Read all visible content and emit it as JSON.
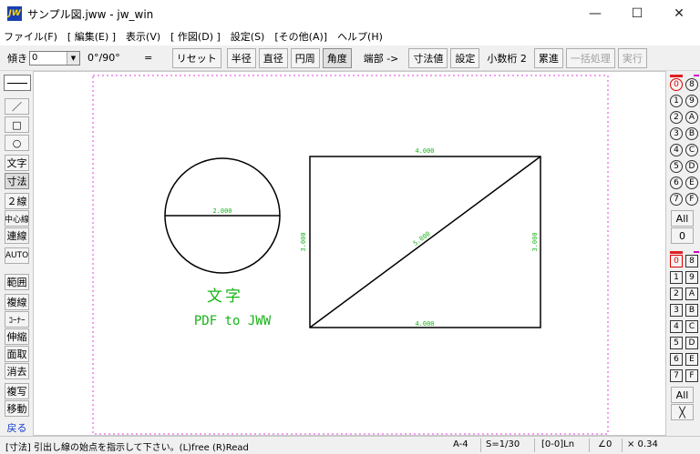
{
  "window": {
    "title": "サンプル図.jww - jw_win",
    "icon_text": "JW",
    "minimize": "—",
    "maximize": "☐",
    "close": "✕"
  },
  "menu": [
    "ファイル(F)",
    "[ 編集(E) ]",
    "表示(V)",
    "[ 作図(D) ]",
    "設定(S)",
    "[その他(A)]",
    "ヘルプ(H)"
  ],
  "toolbar": {
    "slope_label": "傾き",
    "slope_value": "0",
    "angle_toggle": "0°/90°",
    "equal": "=",
    "reset": "リセット",
    "radius": "半径",
    "diameter": "直径",
    "circumference": "円周",
    "angle": "角度",
    "end": "端部 ->",
    "dim_value": "寸法値",
    "settings": "設定",
    "decimal": "小数桁 2",
    "cumulative": "累進",
    "batch": "一括処理",
    "execute": "実行"
  },
  "left_tools": [
    "／",
    "□",
    "○",
    "文字",
    "寸法",
    "２線",
    "中心線",
    "連線",
    "AUTO",
    "範囲",
    "複線",
    "ｺｰﾅｰ",
    "伸縮",
    "面取",
    "消去",
    "複写",
    "移動",
    "戻る"
  ],
  "layer_groups": {
    "circles_left": [
      "0",
      "1",
      "2",
      "3",
      "4",
      "5",
      "6",
      "7"
    ],
    "circles_right": [
      "8",
      "9",
      "A",
      "B",
      "C",
      "D",
      "E",
      "F"
    ],
    "all": "All",
    "zero": "0"
  },
  "layers": {
    "squares_left": [
      "0",
      "1",
      "2",
      "3",
      "4",
      "5",
      "6",
      "7"
    ],
    "squares_right": [
      "8",
      "9",
      "A",
      "B",
      "C",
      "D",
      "E",
      "F"
    ],
    "all": "All",
    "cross": "╳"
  },
  "drawing": {
    "circle_dim": "2.000",
    "text_main": "文字",
    "text_sub": "PDF to JWW",
    "rect_top_dim": "4.000",
    "rect_bottom_dim": "4.000",
    "rect_left_dim": "3.000",
    "rect_right_dim": "3.000",
    "diag_dim": "5.000",
    "text_color": "#19b319",
    "dim_color": "#19b319",
    "frame_color": "#e040e0"
  },
  "status": {
    "message": "[寸法] 引出し線の始点を指示して下さい。(L)free (R)Read",
    "paper": "A-4",
    "scale": "S=1/30",
    "layer": "[0-0]Ln",
    "angle": "∠0",
    "zoom": "× 0.34"
  }
}
